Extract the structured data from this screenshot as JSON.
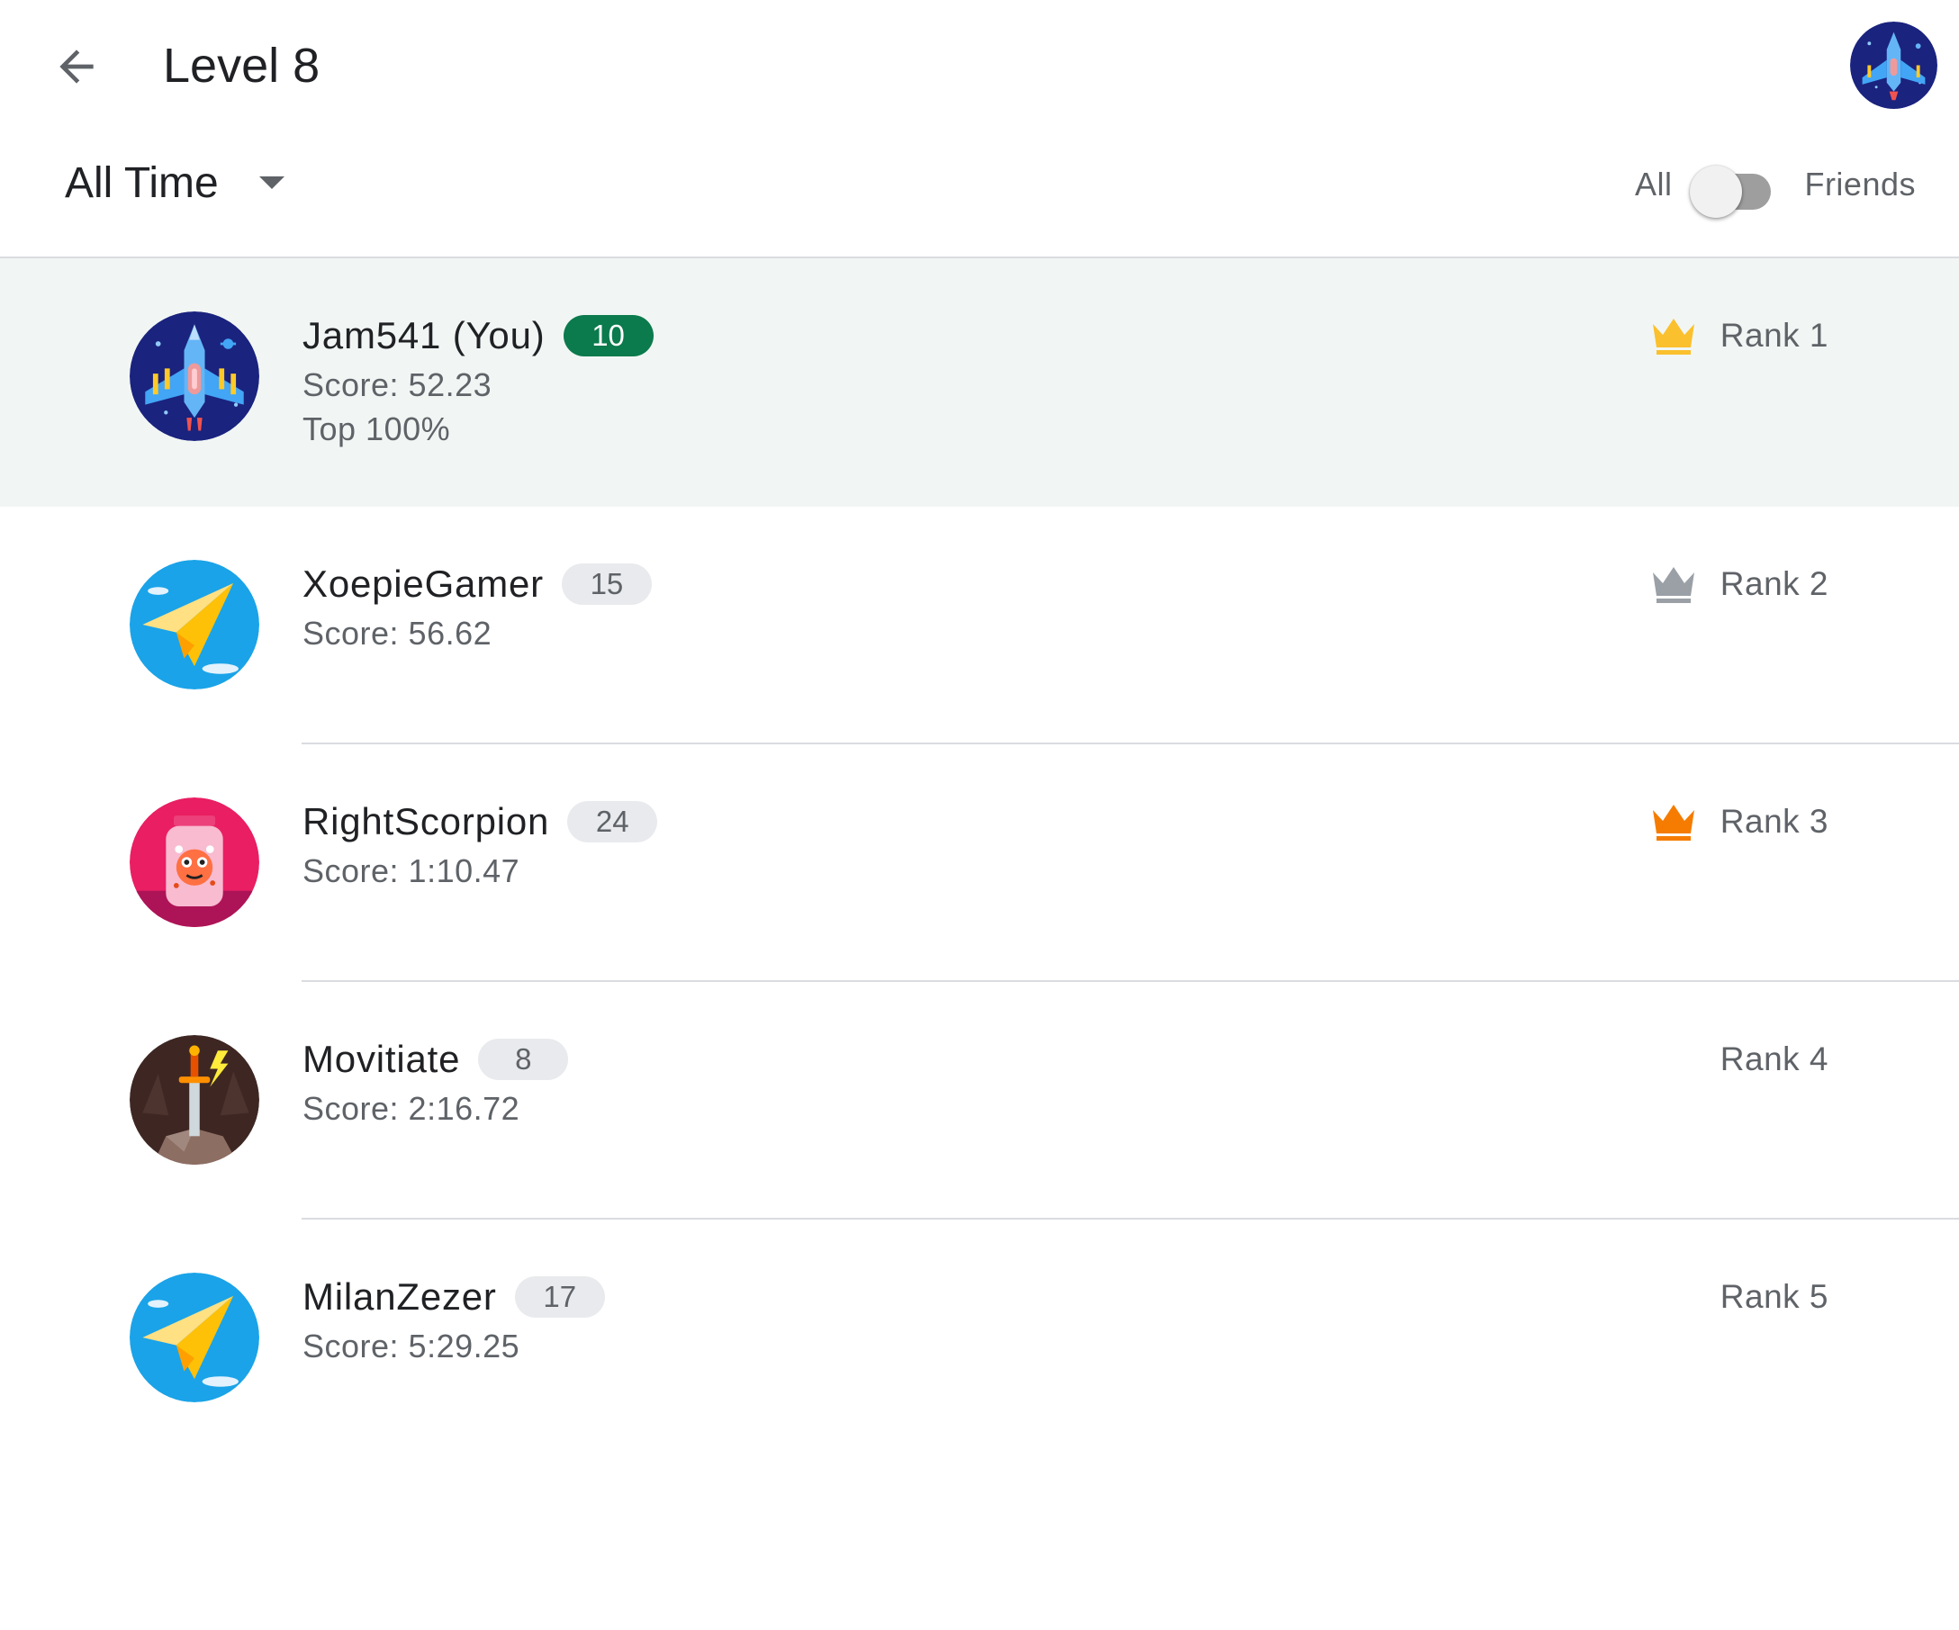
{
  "header": {
    "title": "Level 8"
  },
  "filters": {
    "time_range": "All Time",
    "toggle_left_label": "All",
    "toggle_right_label": "Friends",
    "toggle_state": "All"
  },
  "colors": {
    "me_row_bg": "#f1f6f4",
    "me_badge": "#0b7a4c",
    "gold_crown": "#fbc02d",
    "silver_crown": "#9aa0a6",
    "bronze_crown": "#f57c00"
  },
  "players": [
    {
      "name": "Jam541 (You)",
      "level": "10",
      "score": "Score: 52.23",
      "extra": "Top 100%",
      "rank": "Rank 1",
      "crown": "gold-crown-icon",
      "avatar": "spaceship-icon",
      "is_me": true
    },
    {
      "name": "XoepieGamer",
      "level": "15",
      "score": "Score: 56.62",
      "extra": "",
      "rank": "Rank 2",
      "crown": "silver-crown-icon",
      "avatar": "paper-plane-icon",
      "is_me": false
    },
    {
      "name": "RightScorpion",
      "level": "24",
      "score": "Score: 1:10.47",
      "extra": "",
      "rank": "Rank 3",
      "crown": "bronze-crown-icon",
      "avatar": "monster-jar-icon",
      "is_me": false
    },
    {
      "name": "Movitiate",
      "level": "8",
      "score": "Score: 2:16.72",
      "extra": "",
      "rank": "Rank 4",
      "crown": "",
      "avatar": "sword-in-stone-icon",
      "is_me": false
    },
    {
      "name": "MilanZezer",
      "level": "17",
      "score": "Score: 5:29.25",
      "extra": "",
      "rank": "Rank 5",
      "crown": "",
      "avatar": "paper-plane-icon",
      "is_me": false
    }
  ]
}
